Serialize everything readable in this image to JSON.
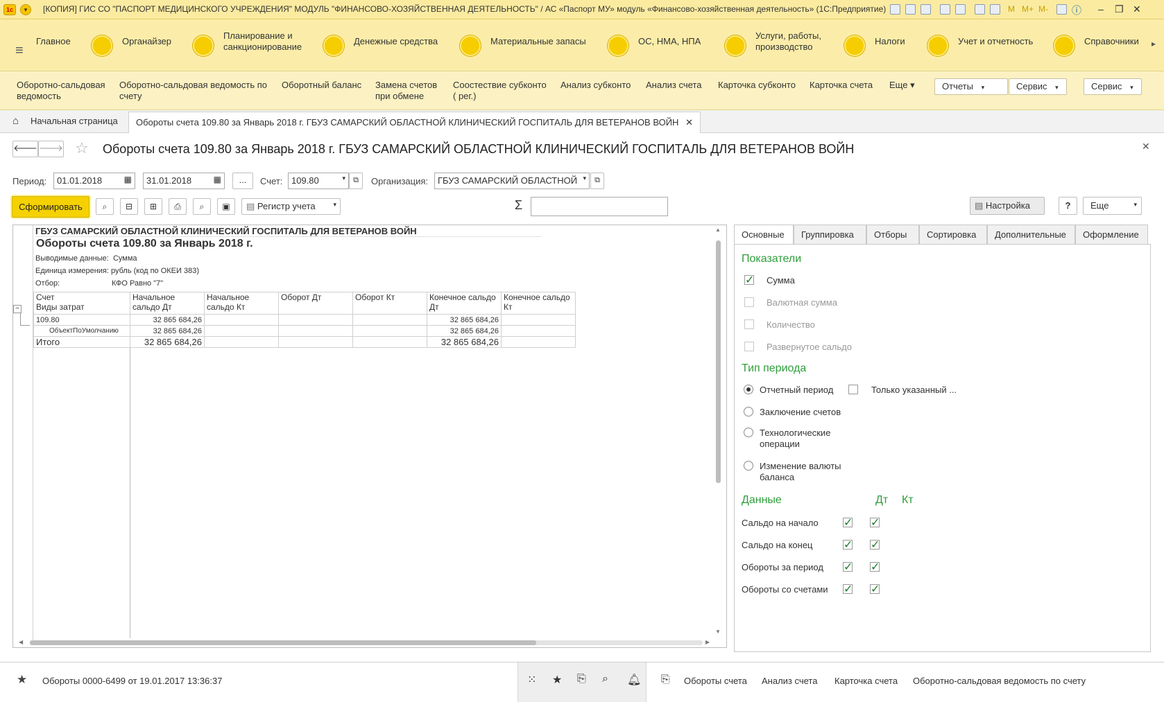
{
  "window": {
    "title": "[КОПИЯ] ГИС СО \"ПАСПОРТ МЕДИЦИНСКОГО УЧРЕЖДЕНИЯ\" МОДУЛЬ \"ФИНАНСОВО-ХОЗЯЙСТВЕННАЯ ДЕЯТЕЛЬНОСТЬ\" / АС «Паспорт МУ» модуль «Финансово-хозяйственная деятельность» (1С:Предприятие)",
    "logo": "1c",
    "toolbar_letters": [
      "M",
      "M+",
      "M-"
    ]
  },
  "sections": {
    "main": "Главное",
    "items": [
      {
        "label": "Органайзер"
      },
      {
        "label": "Планирование и санкционирование"
      },
      {
        "label": "Денежные средства"
      },
      {
        "label": "Материальные запасы"
      },
      {
        "label": "ОС, НМА, НПА"
      },
      {
        "label": "Услуги, работы, производство"
      },
      {
        "label": "Налоги"
      },
      {
        "label": "Учет и отчетность"
      },
      {
        "label": "Справочники"
      }
    ]
  },
  "commands": {
    "items": [
      "Оборотно-сальдовая ведомость",
      "Оборотно-сальдовая ведомость по счету",
      "Оборотный баланс",
      "Замена счетов при обмене",
      "Соостествие субконто ( рег.)",
      "Анализ субконто",
      "Анализ счета",
      "Карточка субконто",
      "Карточка счета"
    ],
    "more": "Еще",
    "dropdowns": [
      "Отчеты",
      "Сервис",
      "Сервис"
    ]
  },
  "tabs": {
    "home": "Начальная страница",
    "active": "Обороты счета 109.80 за Январь 2018 г. ГБУЗ САМАРСКИЙ ОБЛАСТНОЙ КЛИНИЧЕСКИЙ ГОСПИТАЛЬ ДЛЯ ВЕТЕРАНОВ ВОЙН"
  },
  "form": {
    "title": "Обороты счета 109.80 за Январь 2018 г. ГБУЗ САМАРСКИЙ ОБЛАСТНОЙ КЛИНИЧЕСКИЙ ГОСПИТАЛЬ ДЛЯ ВЕТЕРАНОВ ВОЙН",
    "period_label": "Период:",
    "date_from": "01.01.2018",
    "date_to": "31.01.2018",
    "ellipsis": "...",
    "account_label": "Счет:",
    "account": "109.80",
    "org_label": "Организация:",
    "org": "ГБУЗ САМАРСКИЙ ОБЛАСТНОЙ",
    "generate": "Сформировать",
    "register": "Регистр учета",
    "sigma": "Σ",
    "settings": "Настройка",
    "help": "?",
    "more": "Еще"
  },
  "report": {
    "org": "ГБУЗ САМАРСКИЙ ОБЛАСТНОЙ КЛИНИЧЕСКИЙ ГОСПИТАЛЬ ДЛЯ ВЕТЕРАНОВ ВОЙН",
    "title": "Обороты счета 109.80 за Январь 2018 г.",
    "output_label": "Выводимые данные:",
    "output_value": "Сумма",
    "unit_label": "Единица измерения:",
    "unit_value": "рубль (код по ОКЕИ 383)",
    "filter_label": "Отбор:",
    "filter_value": "КФО Равно \"7\"",
    "headers": {
      "col1a": "Счет",
      "col1b": "Виды затрат",
      "col2a": "Начальное",
      "col2b": "сальдо Дт",
      "col3a": "Начальное",
      "col3b": "сальдо Кт",
      "col4": "Оборот Дт",
      "col5": "Оборот Кт",
      "col6a": "Конечное сальдо",
      "col6b": "Дт",
      "col7a": "Конечное сальдо",
      "col7b": "Кт"
    },
    "rows": [
      {
        "name": "109.80",
        "start_dt": "32 865 684,26",
        "end_dt": "32 865 684,26"
      },
      {
        "name": "ОбъектПоУмолчанию",
        "start_dt": "32 865 684,26",
        "end_dt": "32 865 684,26"
      },
      {
        "name": "Итого",
        "start_dt": "32 865 684,26",
        "end_dt": "32 865 684,26"
      }
    ],
    "collapse": "−"
  },
  "panel": {
    "tabs": [
      "Основные",
      "Группировка",
      "Отборы",
      "Сортировка",
      "Дополнительные",
      "Оформление"
    ],
    "indicators_title": "Показатели",
    "indicators": [
      {
        "label": "Сумма",
        "checked": true
      },
      {
        "label": "Валютная сумма",
        "checked": false
      },
      {
        "label": "Количество",
        "checked": false
      },
      {
        "label": "Развернутое сальдо",
        "checked": false
      }
    ],
    "period_type_title": "Тип периода",
    "period_types": [
      "Отчетный период",
      "Заключение счетов",
      "Технологические операции",
      "Изменение валюты баланса"
    ],
    "only_specified": "Только указанный ...",
    "data_title": "Данные",
    "dt": "Дт",
    "kt": "Кт",
    "data_rows": [
      "Сальдо на начало",
      "Сальдо на конец",
      "Обороты за период",
      "Обороты со счетами"
    ]
  },
  "bottom": {
    "history": "Обороты 0000-6499 от 19.01.2017 13:36:37",
    "links": [
      "Обороты счета",
      "Анализ счета",
      "Карточка счета",
      "Оборотно-сальдовая ведомость по счету"
    ]
  },
  "colors": {
    "accent_yellow": "#f5cd00",
    "section_bg": "#fbeda9",
    "group_green": "#2e9e3b"
  }
}
